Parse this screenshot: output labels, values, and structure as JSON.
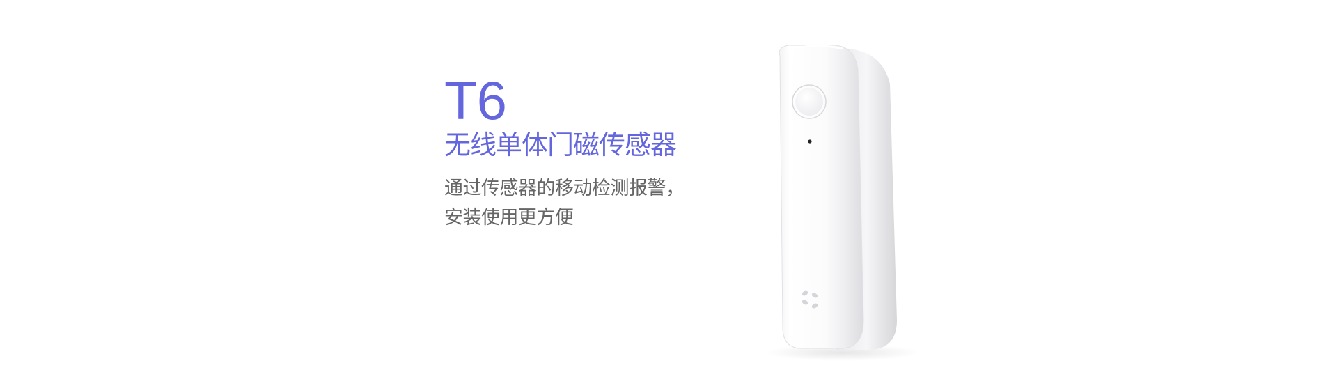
{
  "product": {
    "model": "T6",
    "name": "无线单体门磁传感器",
    "description_lines": [
      "通过传感器的移动检测报警，",
      "安装使用更方便"
    ]
  },
  "colors": {
    "accent": "#6466dd",
    "body_text": "#666666",
    "background": "#ffffff"
  },
  "device_image": {
    "logo_icon": "ezviz-petal-logo-icon"
  }
}
